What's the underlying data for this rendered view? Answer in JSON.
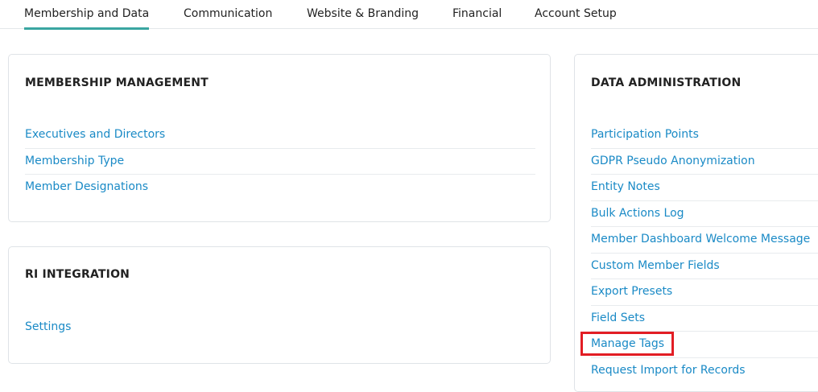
{
  "tabs": [
    {
      "label": "Membership and Data",
      "active": true
    },
    {
      "label": "Communication",
      "active": false
    },
    {
      "label": "Website & Branding",
      "active": false
    },
    {
      "label": "Financial",
      "active": false
    },
    {
      "label": "Account Setup",
      "active": false
    }
  ],
  "membership_management": {
    "title": "MEMBERSHIP MANAGEMENT",
    "links": [
      "Executives and Directors",
      "Membership Type",
      "Member Designations"
    ]
  },
  "ri_integration": {
    "title": "RI INTEGRATION",
    "links": [
      "Settings"
    ]
  },
  "data_administration": {
    "title": "DATA ADMINISTRATION",
    "links": [
      "Participation Points",
      "GDPR Pseudo Anonymization",
      "Entity Notes",
      "Bulk Actions Log",
      "Member Dashboard Welcome Message",
      "Custom Member Fields",
      "Export Presets",
      "Field Sets",
      "Manage Tags",
      "Request Import for Records"
    ],
    "highlighted_link": "Manage Tags"
  },
  "colors": {
    "accent": "#3aa6a1",
    "link": "#1a8ac6",
    "highlight_border": "#e21d24"
  }
}
